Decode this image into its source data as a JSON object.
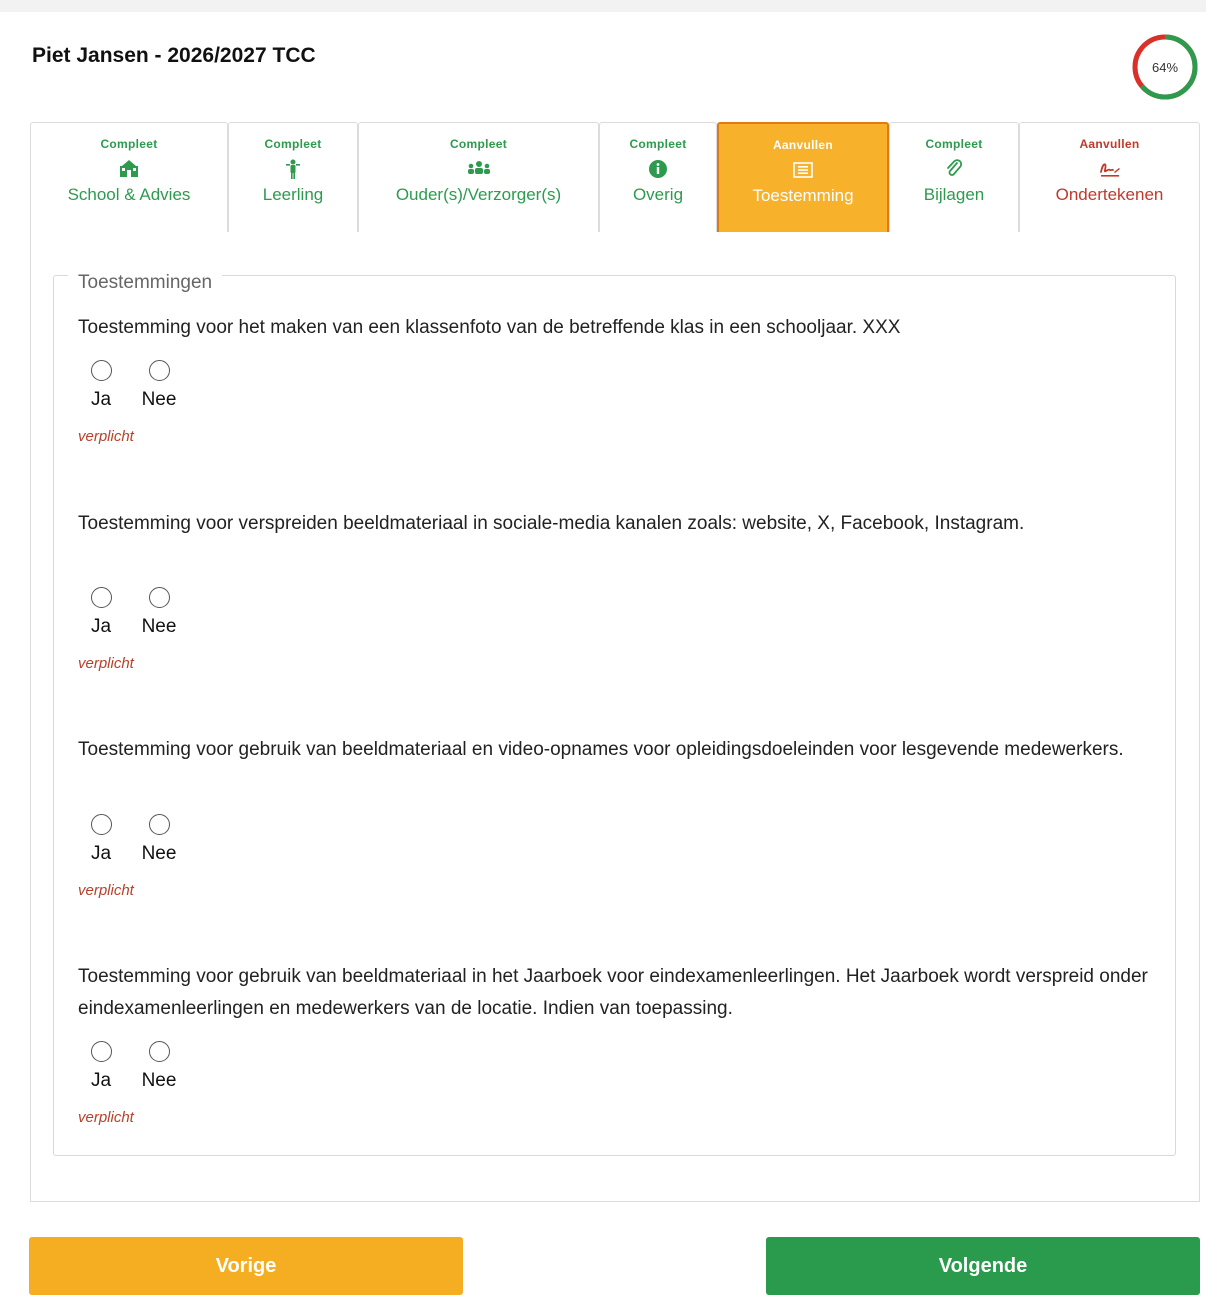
{
  "header": {
    "title": "Piet Jansen - 2026/2027 TCC",
    "progress_label": "64%",
    "progress_value": 0.64
  },
  "colors": {
    "complete": "#2e9a4e",
    "todo": "#c0392b",
    "active": "#f7b12a",
    "prev": "#f5ad22",
    "next": "#2a9a4c"
  },
  "tabs": [
    {
      "status": "Compleet",
      "label": "School & Advies",
      "icon": "school-icon",
      "state": "complete"
    },
    {
      "status": "Compleet",
      "label": "Leerling",
      "icon": "student-icon",
      "state": "complete"
    },
    {
      "status": "Compleet",
      "label": "Ouder(s)/Verzorger(s)",
      "icon": "parents-icon",
      "state": "complete"
    },
    {
      "status": "Compleet",
      "label": "Overig",
      "icon": "info-icon",
      "state": "complete"
    },
    {
      "status": "Aanvullen",
      "label": "Toestemming",
      "icon": "consent-icon",
      "state": "active"
    },
    {
      "status": "Compleet",
      "label": "Bijlagen",
      "icon": "paperclip-icon",
      "state": "complete"
    },
    {
      "status": "Aanvullen",
      "label": "Ondertekenen",
      "icon": "signature-icon",
      "state": "todo"
    }
  ],
  "section": {
    "legend": "Toestemmingen",
    "questions": [
      {
        "text": "Toestemming voor het maken van een klassenfoto van de betreffende klas in een schooljaar. XXX",
        "yes": "Ja",
        "no": "Nee",
        "required": "verplicht"
      },
      {
        "text": "Toestemming voor verspreiden beeldmateriaal in sociale-media kanalen zoals: website, X, Facebook, Instagram.",
        "yes": "Ja",
        "no": "Nee",
        "required": "verplicht"
      },
      {
        "text": "Toestemming voor gebruik van beeldmateriaal en video-opnames voor opleidingsdoeleinden voor lesgevende medewerkers.",
        "yes": "Ja",
        "no": "Nee",
        "required": "verplicht"
      },
      {
        "text": "Toestemming voor gebruik van beeldmateriaal in het Jaarboek voor eindexamenleerlingen. Het Jaarboek wordt verspreid onder eindexamenleerlingen en medewerkers van de locatie. Indien van toepassing.",
        "yes": "Ja",
        "no": "Nee",
        "required": "verplicht"
      }
    ]
  },
  "footer": {
    "prev_label": "Vorige",
    "next_label": "Volgende"
  }
}
